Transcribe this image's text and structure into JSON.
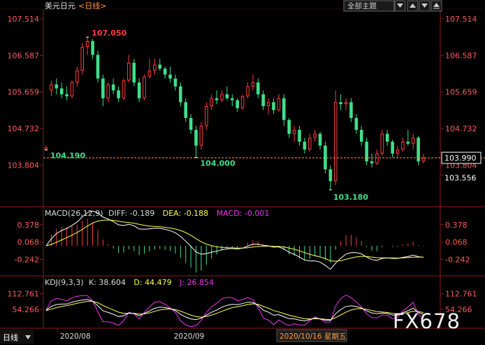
{
  "header": {
    "instrument": "美元日元",
    "period": "<日线>",
    "theme_label": "全部主题"
  },
  "footer": {
    "period_button": "日线",
    "cursor_date": "2020/10/16 星期五",
    "watermark": "FX678"
  },
  "colors": {
    "up": "#ff3c3c",
    "down": "#3ee08a",
    "axis": "#8b1a1a",
    "price_text": "#ff5a5a",
    "dea": "#ffff55",
    "kdj_d": "#ffff55",
    "kdj_j": "#ee33ee"
  },
  "chart_data": [
    {
      "type": "candlestick",
      "x_labels": [
        "2020/08",
        "2020/09",
        "2020/10"
      ],
      "y_ticks": [
        107.514,
        106.587,
        105.659,
        104.732,
        103.804
      ],
      "ylim": [
        103.0,
        107.6
      ],
      "current_price": 103.99,
      "last_low_label": 103.556,
      "annotations": [
        {
          "label": "107.050",
          "value": 107.05,
          "kind": "high"
        },
        {
          "label": "104.190",
          "value": 104.19,
          "kind": "low"
        },
        {
          "label": "104.000",
          "value": 104.0,
          "kind": "low"
        },
        {
          "label": "103.180",
          "value": 103.18,
          "kind": "low"
        }
      ],
      "candles": [
        {
          "o": 104.19,
          "h": 104.3,
          "l": 104.19,
          "c": 104.25
        },
        {
          "o": 105.7,
          "h": 105.95,
          "l": 105.55,
          "c": 105.85
        },
        {
          "o": 105.85,
          "h": 106.0,
          "l": 105.6,
          "c": 105.75
        },
        {
          "o": 105.75,
          "h": 105.9,
          "l": 105.5,
          "c": 105.6
        },
        {
          "o": 105.6,
          "h": 105.8,
          "l": 105.45,
          "c": 105.55
        },
        {
          "o": 105.55,
          "h": 105.95,
          "l": 105.5,
          "c": 105.9
        },
        {
          "o": 105.9,
          "h": 106.3,
          "l": 105.8,
          "c": 106.2
        },
        {
          "o": 106.2,
          "h": 106.9,
          "l": 106.1,
          "c": 106.8
        },
        {
          "o": 106.8,
          "h": 107.05,
          "l": 106.6,
          "c": 106.95
        },
        {
          "o": 106.95,
          "h": 107.0,
          "l": 106.5,
          "c": 106.6
        },
        {
          "o": 106.6,
          "h": 106.7,
          "l": 105.9,
          "c": 106.0
        },
        {
          "o": 106.0,
          "h": 106.1,
          "l": 105.3,
          "c": 105.5
        },
        {
          "o": 105.5,
          "h": 105.9,
          "l": 105.4,
          "c": 105.85
        },
        {
          "o": 105.85,
          "h": 106.0,
          "l": 105.6,
          "c": 105.7
        },
        {
          "o": 105.7,
          "h": 105.8,
          "l": 105.4,
          "c": 105.5
        },
        {
          "o": 105.5,
          "h": 106.0,
          "l": 105.45,
          "c": 105.95
        },
        {
          "o": 105.95,
          "h": 106.6,
          "l": 105.9,
          "c": 106.4
        },
        {
          "o": 106.4,
          "h": 106.5,
          "l": 105.8,
          "c": 105.9
        },
        {
          "o": 105.9,
          "h": 106.0,
          "l": 105.4,
          "c": 105.5
        },
        {
          "o": 105.5,
          "h": 106.1,
          "l": 105.45,
          "c": 106.05
        },
        {
          "o": 106.05,
          "h": 106.5,
          "l": 106.0,
          "c": 106.2
        },
        {
          "o": 106.2,
          "h": 106.5,
          "l": 106.1,
          "c": 106.35
        },
        {
          "o": 106.35,
          "h": 106.5,
          "l": 106.2,
          "c": 106.25
        },
        {
          "o": 106.25,
          "h": 106.3,
          "l": 106.0,
          "c": 106.1
        },
        {
          "o": 106.1,
          "h": 106.3,
          "l": 105.9,
          "c": 106.0
        },
        {
          "o": 106.0,
          "h": 106.1,
          "l": 105.7,
          "c": 105.8
        },
        {
          "o": 105.8,
          "h": 105.9,
          "l": 105.3,
          "c": 105.4
        },
        {
          "o": 105.4,
          "h": 105.5,
          "l": 104.9,
          "c": 105.0
        },
        {
          "o": 105.0,
          "h": 105.1,
          "l": 104.6,
          "c": 104.7
        },
        {
          "o": 104.7,
          "h": 104.8,
          "l": 104.0,
          "c": 104.3
        },
        {
          "o": 104.3,
          "h": 104.9,
          "l": 104.2,
          "c": 104.8
        },
        {
          "o": 104.8,
          "h": 105.4,
          "l": 104.7,
          "c": 105.3
        },
        {
          "o": 105.3,
          "h": 105.6,
          "l": 105.2,
          "c": 105.5
        },
        {
          "o": 105.5,
          "h": 105.7,
          "l": 105.35,
          "c": 105.45
        },
        {
          "o": 105.45,
          "h": 105.7,
          "l": 105.4,
          "c": 105.6
        },
        {
          "o": 105.6,
          "h": 105.8,
          "l": 105.45,
          "c": 105.5
        },
        {
          "o": 105.5,
          "h": 105.6,
          "l": 105.3,
          "c": 105.45
        },
        {
          "o": 105.45,
          "h": 105.5,
          "l": 105.15,
          "c": 105.25
        },
        {
          "o": 105.25,
          "h": 105.6,
          "l": 105.2,
          "c": 105.55
        },
        {
          "o": 105.55,
          "h": 105.9,
          "l": 105.5,
          "c": 105.8
        },
        {
          "o": 105.8,
          "h": 106.1,
          "l": 105.7,
          "c": 105.9
        },
        {
          "o": 105.9,
          "h": 106.0,
          "l": 105.5,
          "c": 105.6
        },
        {
          "o": 105.6,
          "h": 105.7,
          "l": 105.2,
          "c": 105.3
        },
        {
          "o": 105.3,
          "h": 105.5,
          "l": 105.1,
          "c": 105.4
        },
        {
          "o": 105.4,
          "h": 105.5,
          "l": 105.1,
          "c": 105.2
        },
        {
          "o": 105.2,
          "h": 105.6,
          "l": 105.15,
          "c": 105.5
        },
        {
          "o": 105.5,
          "h": 105.6,
          "l": 104.8,
          "c": 104.95
        },
        {
          "o": 104.95,
          "h": 105.0,
          "l": 104.5,
          "c": 104.6
        },
        {
          "o": 104.6,
          "h": 104.8,
          "l": 104.4,
          "c": 104.7
        },
        {
          "o": 104.7,
          "h": 104.8,
          "l": 104.3,
          "c": 104.4
        },
        {
          "o": 104.4,
          "h": 104.5,
          "l": 104.1,
          "c": 104.2
        },
        {
          "o": 104.2,
          "h": 104.6,
          "l": 104.15,
          "c": 104.5
        },
        {
          "o": 104.5,
          "h": 104.7,
          "l": 104.4,
          "c": 104.6
        },
        {
          "o": 104.6,
          "h": 104.65,
          "l": 104.2,
          "c": 104.3
        },
        {
          "o": 104.3,
          "h": 104.4,
          "l": 103.6,
          "c": 103.7
        },
        {
          "o": 103.7,
          "h": 103.8,
          "l": 103.18,
          "c": 103.4
        },
        {
          "o": 103.4,
          "h": 105.7,
          "l": 103.3,
          "c": 105.4
        },
        {
          "o": 105.4,
          "h": 105.6,
          "l": 105.2,
          "c": 105.35
        },
        {
          "o": 105.35,
          "h": 105.5,
          "l": 105.2,
          "c": 105.4
        },
        {
          "o": 105.4,
          "h": 105.5,
          "l": 104.9,
          "c": 105.0
        },
        {
          "o": 105.0,
          "h": 105.1,
          "l": 104.6,
          "c": 104.7
        },
        {
          "o": 104.7,
          "h": 104.8,
          "l": 104.3,
          "c": 104.4
        },
        {
          "o": 104.4,
          "h": 104.5,
          "l": 103.8,
          "c": 103.9
        },
        {
          "o": 103.9,
          "h": 104.1,
          "l": 103.75,
          "c": 103.85
        },
        {
          "o": 103.85,
          "h": 104.2,
          "l": 103.8,
          "c": 104.1
        },
        {
          "o": 104.1,
          "h": 104.7,
          "l": 104.05,
          "c": 104.6
        },
        {
          "o": 104.6,
          "h": 104.7,
          "l": 104.3,
          "c": 104.4
        },
        {
          "o": 104.4,
          "h": 104.45,
          "l": 104.0,
          "c": 104.1
        },
        {
          "o": 104.1,
          "h": 104.3,
          "l": 104.0,
          "c": 104.2
        },
        {
          "o": 104.2,
          "h": 104.5,
          "l": 104.15,
          "c": 104.4
        },
        {
          "o": 104.4,
          "h": 104.7,
          "l": 104.3,
          "c": 104.35
        },
        {
          "o": 104.35,
          "h": 104.6,
          "l": 104.2,
          "c": 104.5
        },
        {
          "o": 104.5,
          "h": 104.55,
          "l": 103.8,
          "c": 103.9
        },
        {
          "o": 103.9,
          "h": 104.1,
          "l": 103.85,
          "c": 103.99
        }
      ]
    },
    {
      "type": "macd",
      "params": "MACD(26,12,9)",
      "diff_label": "DIFF:",
      "diff": -0.189,
      "dea_label": "DEA:",
      "dea": -0.188,
      "macd_label": "MACD:",
      "macd": -0.001,
      "y_ticks": [
        0.378,
        0.068,
        -0.242
      ],
      "ylim": [
        -0.5,
        0.5
      ]
    },
    {
      "type": "kdj",
      "params": "KDJ(9,3,3)",
      "k_label": "K:",
      "k": 38.604,
      "d_label": "D:",
      "d": 44.479,
      "j_label": "J:",
      "j": 26.854,
      "y_ticks": [
        112.761,
        54.266
      ],
      "ylim": [
        -10,
        135
      ]
    }
  ]
}
